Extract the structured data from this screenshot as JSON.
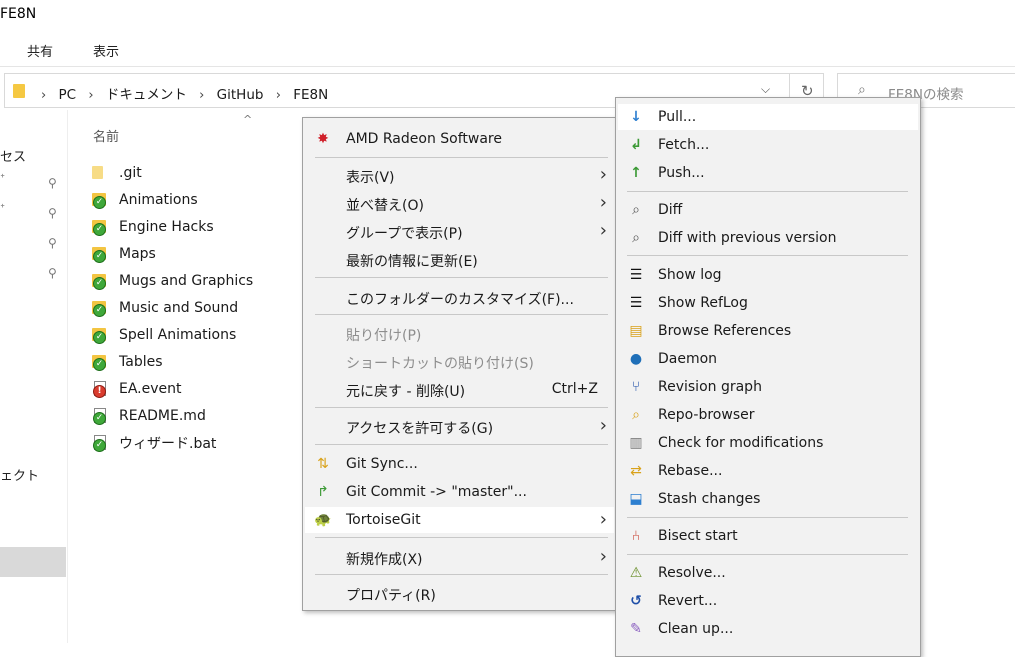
{
  "window": {
    "title": "FE8N"
  },
  "ribbon": {
    "tabs": [
      "共有",
      "表示"
    ]
  },
  "address": {
    "crumbs": [
      "PC",
      "ドキュメント",
      "GitHub",
      "FE8N"
    ]
  },
  "search": {
    "placeholder": "FE8Nの検索"
  },
  "nav": {
    "fragments": [
      "セス",
      "ェクト"
    ]
  },
  "filelist": {
    "column_name": "名前",
    "files": [
      {
        "name": ".git",
        "icon": "folder-icon"
      },
      {
        "name": "Animations",
        "icon": "folder-git-ok-icon"
      },
      {
        "name": "Engine Hacks",
        "icon": "folder-git-ok-icon"
      },
      {
        "name": "Maps",
        "icon": "folder-git-ok-icon"
      },
      {
        "name": "Mugs and Graphics",
        "icon": "folder-git-ok-icon"
      },
      {
        "name": "Music and Sound",
        "icon": "folder-git-ok-icon"
      },
      {
        "name": "Spell Animations",
        "icon": "folder-git-ok-icon"
      },
      {
        "name": "Tables",
        "icon": "folder-git-ok-icon"
      },
      {
        "name": "EA.event",
        "icon": "file-git-modified-icon"
      },
      {
        "name": "README.md",
        "icon": "file-git-ok-icon"
      },
      {
        "name": "ウィザード.bat",
        "icon": "file-git-ok-icon"
      }
    ]
  },
  "context_menu": {
    "items": [
      {
        "label": "AMD Radeon Software",
        "icon": "amd-radeon-icon"
      },
      {
        "label": "表示(V)",
        "submenu": true
      },
      {
        "label": "並べ替え(O)",
        "submenu": true
      },
      {
        "label": "グループで表示(P)",
        "submenu": true
      },
      {
        "label": "最新の情報に更新(E)"
      },
      {
        "label": "このフォルダーのカスタマイズ(F)..."
      },
      {
        "label": "貼り付け(P)",
        "disabled": true
      },
      {
        "label": "ショートカットの貼り付け(S)",
        "disabled": true
      },
      {
        "label": "元に戻す - 削除(U)",
        "shortcut": "Ctrl+Z"
      },
      {
        "label": "アクセスを許可する(G)",
        "submenu": true
      },
      {
        "label": "Git Sync...",
        "icon": "git-sync-icon"
      },
      {
        "label": "Git Commit -> \"master\"...",
        "icon": "git-commit-icon"
      },
      {
        "label": "TortoiseGit",
        "icon": "tortoisegit-icon",
        "submenu": true
      },
      {
        "label": "新規作成(X)",
        "submenu": true
      },
      {
        "label": "プロパティ(R)"
      }
    ]
  },
  "tortoisegit_menu": {
    "items": [
      {
        "label": "Pull...",
        "icon": "pull-icon"
      },
      {
        "label": "Fetch...",
        "icon": "fetch-icon"
      },
      {
        "label": "Push...",
        "icon": "push-icon"
      },
      {
        "label": "Diff",
        "icon": "diff-magnifier-icon"
      },
      {
        "label": "Diff with previous version",
        "icon": "diff-magnifier-icon"
      },
      {
        "label": "Show log",
        "icon": "show-log-icon"
      },
      {
        "label": "Show RefLog",
        "icon": "show-reflog-icon"
      },
      {
        "label": "Browse References",
        "icon": "browse-references-icon"
      },
      {
        "label": "Daemon",
        "icon": "globe-icon"
      },
      {
        "label": "Revision graph",
        "icon": "revision-graph-icon"
      },
      {
        "label": "Repo-browser",
        "icon": "repo-browser-icon"
      },
      {
        "label": "Check for modifications",
        "icon": "check-modifications-icon"
      },
      {
        "label": "Rebase...",
        "icon": "rebase-icon"
      },
      {
        "label": "Stash changes",
        "icon": "stash-icon"
      },
      {
        "label": "Bisect start",
        "icon": "bisect-icon"
      },
      {
        "label": "Resolve...",
        "icon": "resolve-icon"
      },
      {
        "label": "Revert...",
        "icon": "revert-icon"
      },
      {
        "label": "Clean up...",
        "icon": "clean-up-icon"
      }
    ]
  }
}
